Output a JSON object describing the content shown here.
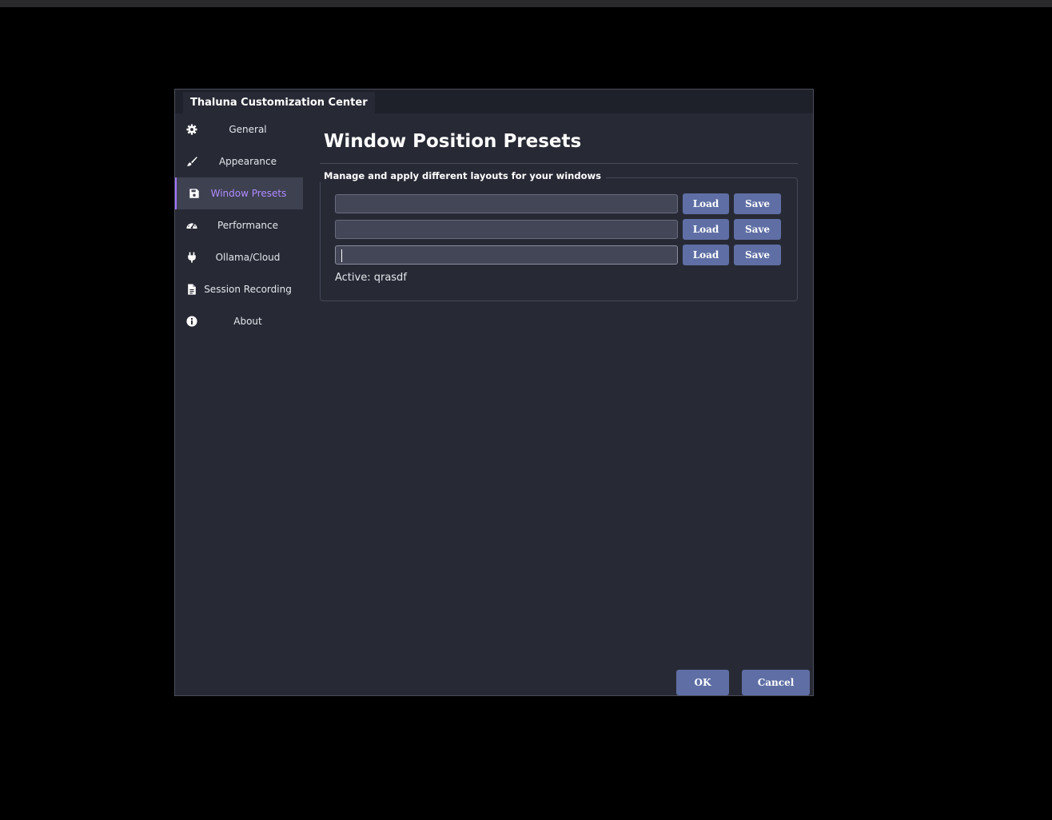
{
  "window": {
    "title": "Thaluna Customization Center"
  },
  "sidebar": {
    "items": [
      {
        "label": "General",
        "icon": "gear-icon"
      },
      {
        "label": "Appearance",
        "icon": "paintbrush-icon"
      },
      {
        "label": "Window Presets",
        "icon": "floppy-disk-icon",
        "active": true
      },
      {
        "label": "Performance",
        "icon": "gauge-icon"
      },
      {
        "label": "Ollama/Cloud",
        "icon": "plug-icon"
      },
      {
        "label": "Session Recording",
        "icon": "document-icon"
      },
      {
        "label": "About",
        "icon": "info-icon"
      }
    ]
  },
  "main": {
    "title": "Window Position Presets",
    "group_title": "Manage and apply different layouts for your windows",
    "presets": [
      {
        "value": "",
        "load_label": "Load",
        "save_label": "Save"
      },
      {
        "value": "",
        "load_label": "Load",
        "save_label": "Save"
      },
      {
        "value": "",
        "load_label": "Load",
        "save_label": "Save",
        "focused": true
      }
    ],
    "active_text": "Active: qrasdf"
  },
  "footer": {
    "ok_label": "OK",
    "cancel_label": "Cancel"
  },
  "colors": {
    "background": "#000000",
    "dialog": "#272a35",
    "accent": "#a277ff",
    "button": "#5f6fa5"
  }
}
